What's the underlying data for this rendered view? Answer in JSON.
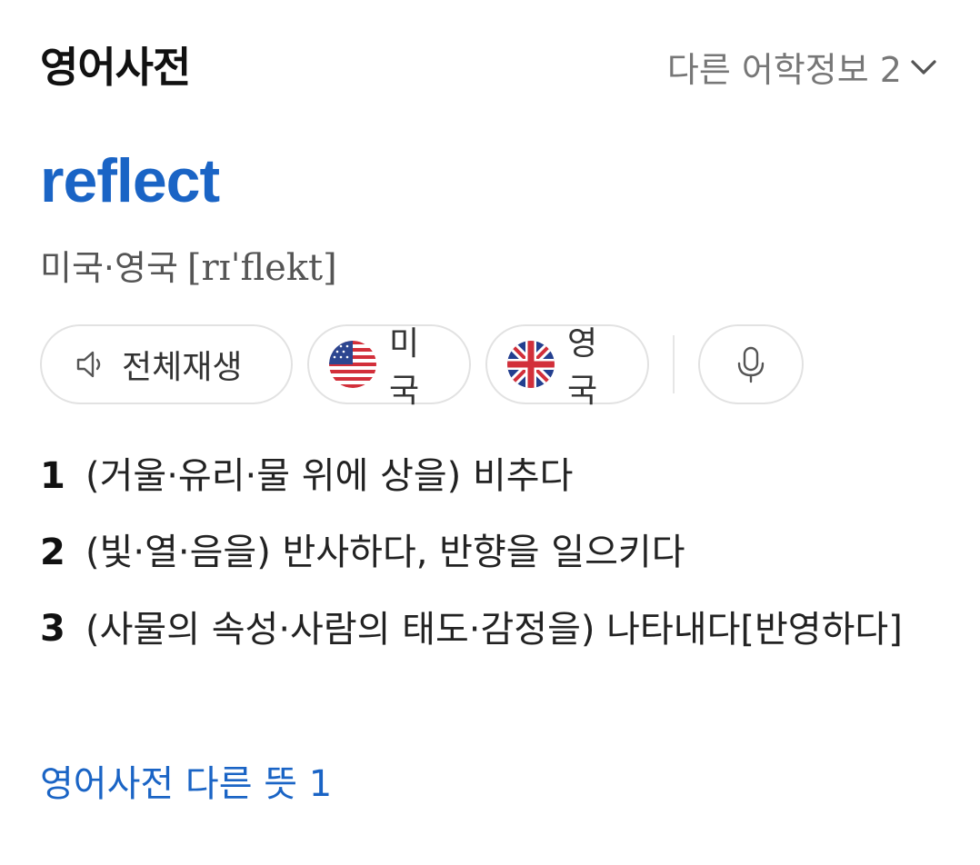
{
  "header": {
    "title": "영어사전",
    "other_info_label": "다른 어학정보 2"
  },
  "entry": {
    "word": "reflect",
    "pron_region": "미국·영국",
    "pron_ipa": "[rɪˈflekt]"
  },
  "audio_buttons": {
    "play_all": "전체재생",
    "us": "미국",
    "uk": "영국"
  },
  "definitions": [
    {
      "num": "1",
      "text": "(거울·유리·물 위에 상을) 비추다"
    },
    {
      "num": "2",
      "text": "(빛·열·음을) 반사하다, 반향을 일으키다"
    },
    {
      "num": "3",
      "text": "(사물의 속성·사람의 태도·감정을) 나타내다[반영하다]"
    }
  ],
  "more_link": "영어사전 다른 뜻 1",
  "colors": {
    "accent": "#1a64c5",
    "muted": "#777777",
    "border": "#e2e2e2"
  },
  "icons": [
    "chevron-down-icon",
    "speaker-icon",
    "us-flag-icon",
    "uk-flag-icon",
    "microphone-icon"
  ]
}
